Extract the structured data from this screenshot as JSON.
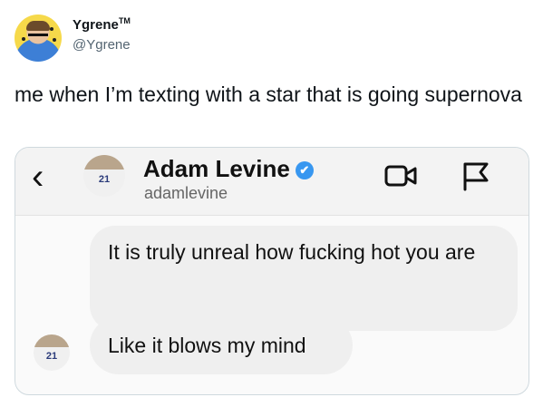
{
  "tweet": {
    "display_name": "Ygrene",
    "trademark": "TM",
    "handle": "@Ygrene",
    "text": "me when I’m texting with a star that is going supernova"
  },
  "dm": {
    "contact_name": "Adam Levine",
    "contact_handle": "adamlevine",
    "back_icon": "chevron-left-icon",
    "video_icon": "video-camera-icon",
    "flag_icon": "flag-icon",
    "verified_badge": "✔",
    "jersey": "21",
    "messages": [
      "It is truly unreal how fucking hot you are",
      "Like it blows my mind"
    ],
    "accent": "#3897f0"
  }
}
